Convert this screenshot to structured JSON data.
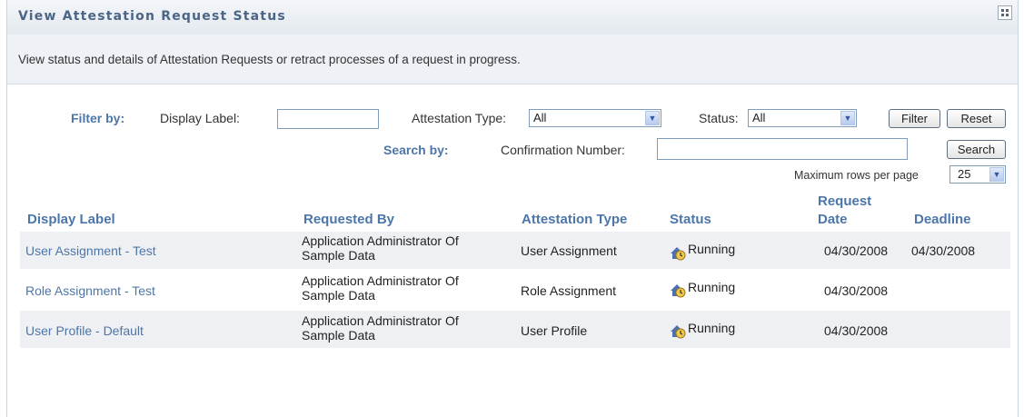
{
  "header": {
    "title": "View Attestation Request Status"
  },
  "description": "View status and details of Attestation Requests or retract processes of a request in progress.",
  "filter": {
    "filter_by_label": "Filter by:",
    "display_label_label": "Display Label:",
    "display_label_value": "",
    "attestation_type_label": "Attestation Type:",
    "attestation_type_value": "All",
    "status_label": "Status:",
    "status_value": "All",
    "filter_button": "Filter",
    "reset_button": "Reset"
  },
  "search": {
    "search_by_label": "Search by:",
    "confirmation_label": "Confirmation Number:",
    "confirmation_value": "",
    "search_button": "Search"
  },
  "paging": {
    "max_rows_label": "Maximum rows per page",
    "max_rows_value": "25"
  },
  "table": {
    "columns": [
      "Display Label",
      "Requested By",
      "Attestation Type",
      "Status",
      "Request Date",
      "Deadline"
    ],
    "request_date_line1": "Request",
    "request_date_line2": "Date",
    "rows": [
      {
        "display_label": "User Assignment - Test",
        "requested_by_line1": "Application Administrator Of",
        "requested_by_line2": "Sample Data",
        "attestation_type": "User Assignment",
        "status": "Running",
        "request_date": "04/30/2008",
        "deadline": "04/30/2008"
      },
      {
        "display_label": "Role Assignment - Test",
        "requested_by_line1": "Application Administrator Of",
        "requested_by_line2": "Sample Data",
        "attestation_type": "Role Assignment",
        "status": "Running",
        "request_date": "04/30/2008",
        "deadline": ""
      },
      {
        "display_label": "User Profile - Default",
        "requested_by_line1": "Application Administrator Of",
        "requested_by_line2": "Sample Data",
        "attestation_type": "User Profile",
        "status": "Running",
        "request_date": "04/30/2008",
        "deadline": ""
      }
    ]
  },
  "icons": {
    "status": "running-clock-icon",
    "dropdown": "chevron-down-icon",
    "panel_menu": "grid-menu-icon"
  },
  "colors": {
    "accent": "#4d76a8",
    "header_title": "#4a6585",
    "row_shade": "#eef0f3"
  }
}
